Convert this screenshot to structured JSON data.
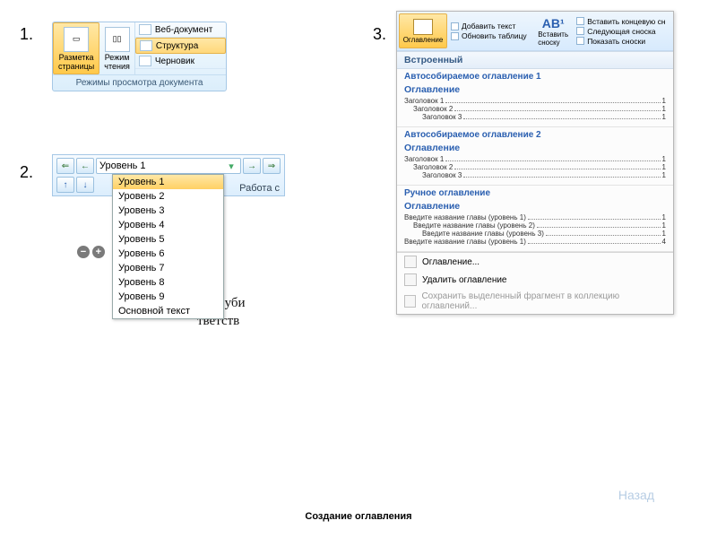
{
  "nums": {
    "one": "1.",
    "two": "2.",
    "three": "3."
  },
  "panel1": {
    "page_layout": "Разметка\nстраницы",
    "reading": "Режим\nчтения",
    "web": "Веб-документ",
    "structure": "Структура",
    "draft": "Черновик",
    "caption": "Режимы просмотра документа"
  },
  "panel2": {
    "selected": "Уровень 1",
    "side_label": "Работа с",
    "options": [
      "Уровень 1",
      "Уровень 2",
      "Уровень 3",
      "Уровень 4",
      "Уровень 5",
      "Уровень 6",
      "Уровень 7",
      "Уровень 8",
      "Уровень 9",
      "Основной текст"
    ],
    "doc_snip1": "ных·уби",
    "doc_snip2": "тветств"
  },
  "panel3": {
    "big_btn": "Оглавление",
    "rib": {
      "add_text": "Добавить текст",
      "update": "Обновить таблицу",
      "ab_btn": "Вставить\nсноску",
      "fn_end": "Вставить концевую сн",
      "fn_next": "Следующая сноска",
      "fn_show": "Показать сноски"
    },
    "builtin_header": "Встроенный",
    "items": [
      {
        "name": "Автособираемое оглавление 1",
        "title": "Оглавление",
        "lines": [
          {
            "t": "Заголовок 1",
            "p": "1",
            "i": 0
          },
          {
            "t": "Заголовок 2",
            "p": "1",
            "i": 1
          },
          {
            "t": "Заголовок 3",
            "p": "1",
            "i": 2
          }
        ]
      },
      {
        "name": "Автособираемое оглавление 2",
        "title": "Оглавление",
        "lines": [
          {
            "t": "Заголовок 1",
            "p": "1",
            "i": 0
          },
          {
            "t": "Заголовок 2",
            "p": "1",
            "i": 1
          },
          {
            "t": "Заголовок 3",
            "p": "1",
            "i": 2
          }
        ]
      },
      {
        "name": "Ручное оглавление",
        "title": "Оглавление",
        "lines": [
          {
            "t": "Введите название главы (уровень 1)",
            "p": "1",
            "i": 0
          },
          {
            "t": "Введите название главы (уровень 2)",
            "p": "1",
            "i": 1
          },
          {
            "t": "Введите название главы (уровень 3)",
            "p": "1",
            "i": 2
          },
          {
            "t": "Введите название главы (уровень 1)",
            "p": "4",
            "i": 0
          }
        ]
      }
    ],
    "footer": {
      "insert": "Оглавление...",
      "remove": "Удалить оглавление",
      "save": "Сохранить выделенный фрагмент в коллекцию оглавлений..."
    }
  },
  "footer_title": "Создание оглавления",
  "back": "Назад"
}
